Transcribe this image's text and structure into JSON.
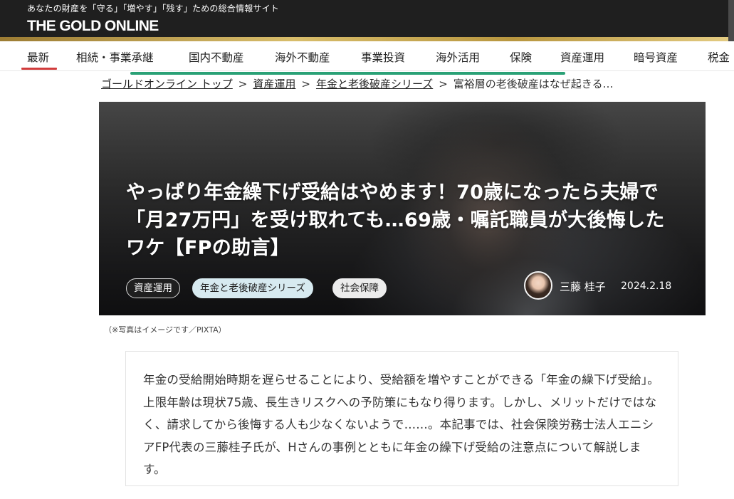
{
  "header": {
    "tagline": "あなたの財産を「守る」「増やす」「残す」ための総合情報サイト",
    "logo": "THE GOLD ONLINE"
  },
  "nav": {
    "items": [
      {
        "label": "最新",
        "active": true
      },
      {
        "label": "相続・事業承継"
      },
      {
        "label": "国内不動産"
      },
      {
        "label": "海外不動産"
      },
      {
        "label": "事業投資"
      },
      {
        "label": "海外活用"
      },
      {
        "label": "保険"
      },
      {
        "label": "資産運用"
      },
      {
        "label": "暗号資産"
      },
      {
        "label": "税金"
      }
    ]
  },
  "breadcrumb": {
    "items": [
      "ゴールドオンライン トップ",
      "資産運用",
      "年金と老後破産シリーズ"
    ],
    "current": "富裕層の老後破産はなぜ起きる…",
    "separator": ">"
  },
  "article": {
    "title": "やっぱり年金繰下げ受給はやめます！70歳になったら夫婦で「月27万円」を受け取れても…69歳・嘱託職員が大後悔したワケ【FPの助言】",
    "tags": [
      "資産運用",
      "年金と老後破産シリーズ",
      "社会保障"
    ],
    "author": "三藤 桂子",
    "date": "2024.2.18",
    "photo_credit": "（※写真はイメージです／PIXTA）",
    "lead": "年金の受給開始時期を遅らせることにより、受給額を増やすことができる「年金の繰下げ受給」。上限年齢は現状75歳、長生きリスクへの予防策にもなり得ります。しかし、メリットだけではなく、請求してから後悔する人も少なくないようで……。本記事では、社会保険労務士法人エニシアFP代表の三藤桂子氏が、Hさんの事例とともに年金の繰下げ受給の注意点について解説します。"
  },
  "colors": {
    "header_bg": "#1f1f1f",
    "gold_band": "#c9a94f",
    "nav_active": "#d13c3c",
    "nav_scroll_indicator": "#2aa176",
    "tag_series_bg": "#d7eaf0"
  }
}
